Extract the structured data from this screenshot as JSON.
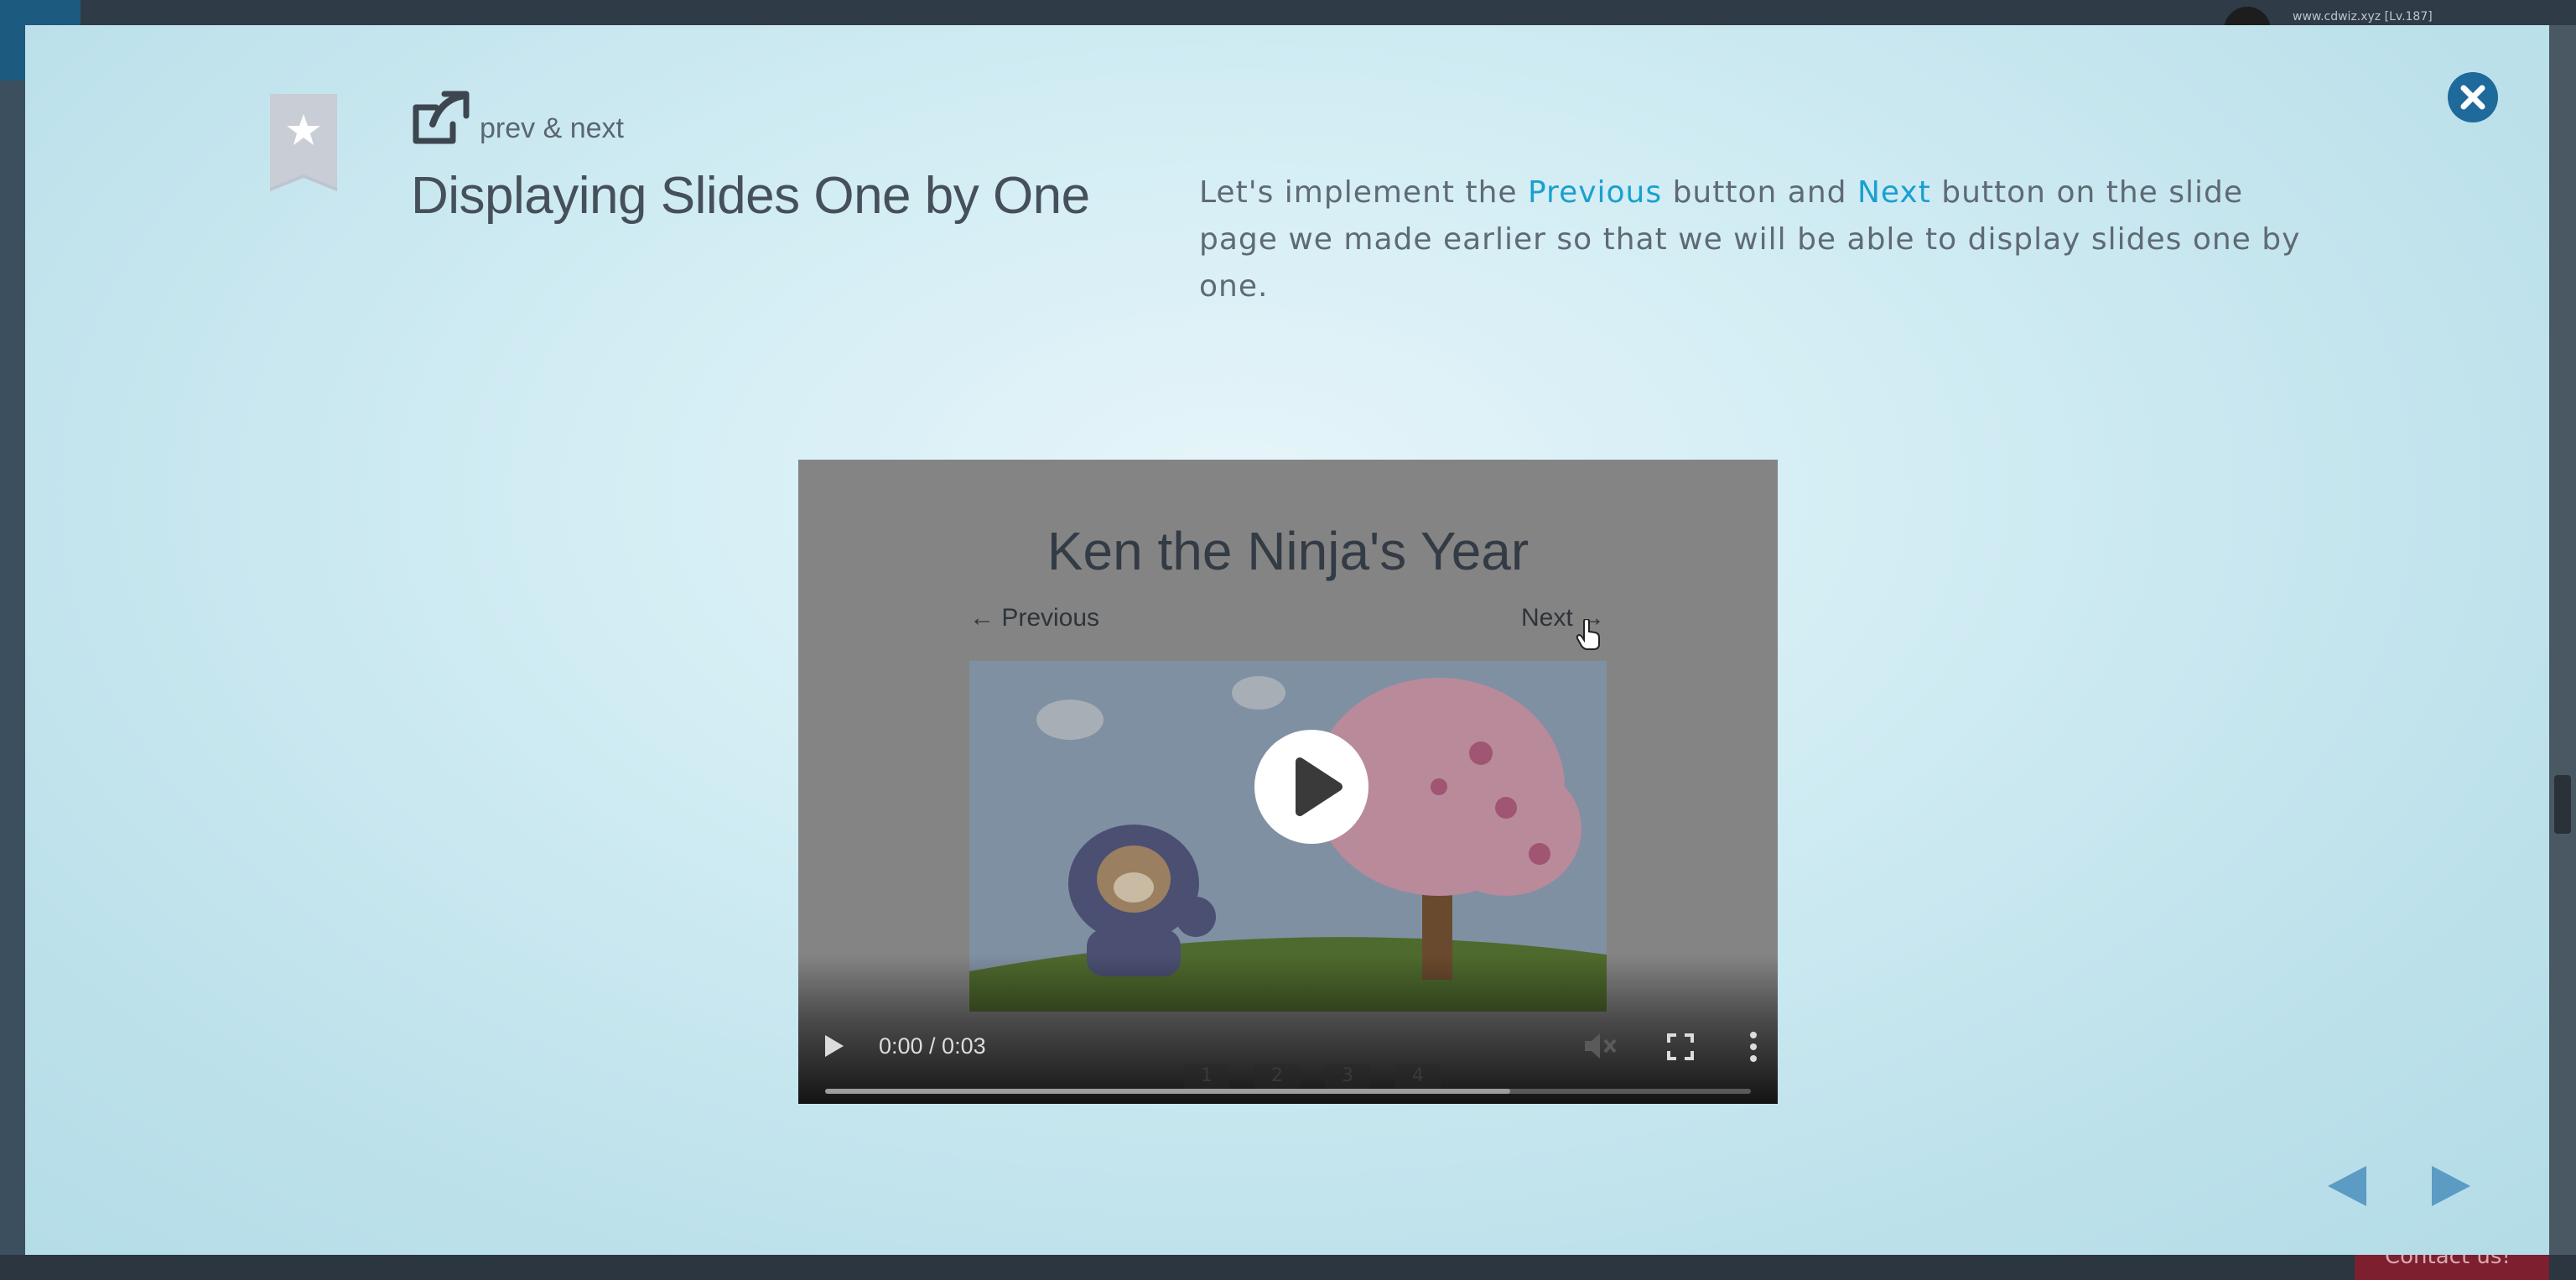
{
  "background": {
    "username": "www.cdwiz.xyz [Lv.187]",
    "contact_label": "Contact us!"
  },
  "modal": {
    "subtitle": "prev & next",
    "title": "Displaying Slides One by One",
    "description": {
      "part1": "Let's implement the ",
      "prev_highlight": "Previous",
      "part2": " button and ",
      "next_highlight": "Next",
      "part3": " button on the slide page we made earlier so that we will be able to display slides one by one."
    },
    "colors": {
      "accent": "#1aa0cf",
      "close_button": "#1e6a9a",
      "nav_arrows": "#5b9bc4"
    }
  },
  "video": {
    "slide_title": "Ken the Ninja's Year",
    "prev_link": "← Previous",
    "next_link": "Next →",
    "page_numbers": [
      "1",
      "2",
      "3",
      "4"
    ],
    "time": "0:00 / 0:03",
    "progress_fraction": 0.74
  },
  "icons": {
    "close": "close-icon",
    "bookmark": "bookmark-star-icon",
    "share": "external-link-icon",
    "play": "play-icon",
    "mute": "volume-muted-icon",
    "fullscreen": "fullscreen-icon",
    "more": "more-vertical-icon",
    "prev_arrow": "triangle-left-icon",
    "next_arrow": "triangle-right-icon"
  }
}
